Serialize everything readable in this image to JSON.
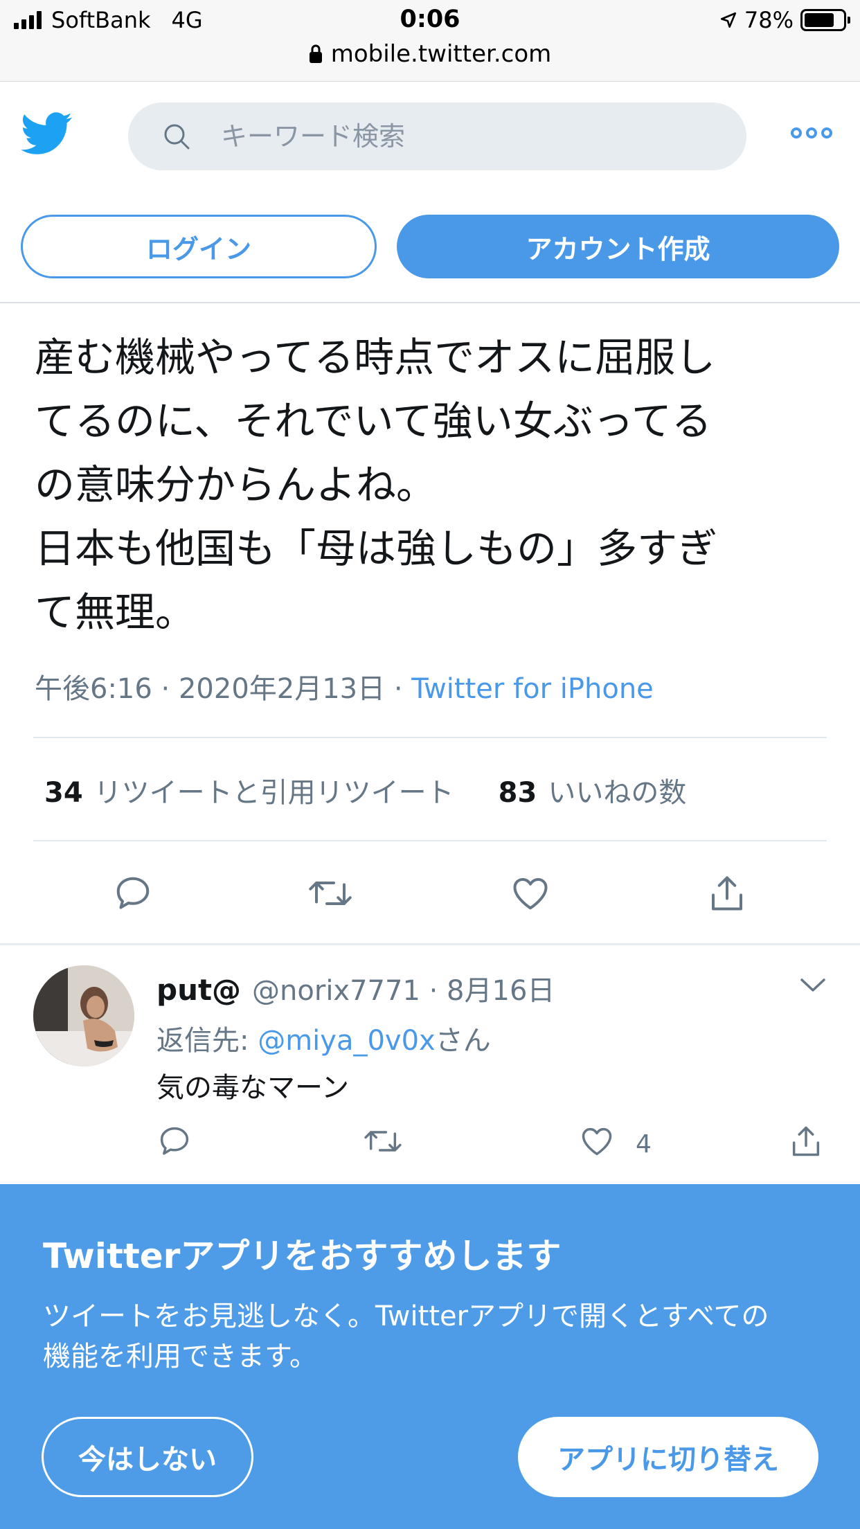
{
  "status_bar": {
    "carrier": "SoftBank",
    "network": "4G",
    "time": "0:06",
    "battery": "78%",
    "battery_level": 0.78,
    "url": "mobile.twitter.com"
  },
  "header": {
    "search_placeholder": "キーワード検索",
    "login_label": "ログイン",
    "signup_label": "アカウント作成"
  },
  "tweet": {
    "text": "産む機械やってる時点でオスに屈服し\nてるのに、それでいて強い女ぶってる\nの意味分からんよね。\n日本も他国も「母は強しもの」多すぎ\nて無理。",
    "timestamp": "午後6:16 · 2020年2月13日 · ",
    "source": "Twitter for iPhone",
    "retweet_count": "34",
    "retweet_label": "リツイートと引用リツイート",
    "like_count": "83",
    "like_label": "いいねの数"
  },
  "reply": {
    "name": "put@",
    "handle_date": "@norix7771 · 8月16日",
    "reply_prefix": "返信先: ",
    "reply_handle": "@miya_0v0x",
    "reply_suffix": "さん",
    "text": "気の毒なマーン",
    "like_count": "4"
  },
  "banner": {
    "title": "Twitterアプリをおすすめします",
    "description": "ツイートをお見逃しなく。Twitterアプリで開くとすべての\n機能を利用できます。",
    "later_label": "今はしない",
    "switch_label": "アプリに切り替え"
  },
  "colors": {
    "accent": "#4a99e9",
    "banner": "#4e9ce8",
    "muted": "#657786"
  }
}
